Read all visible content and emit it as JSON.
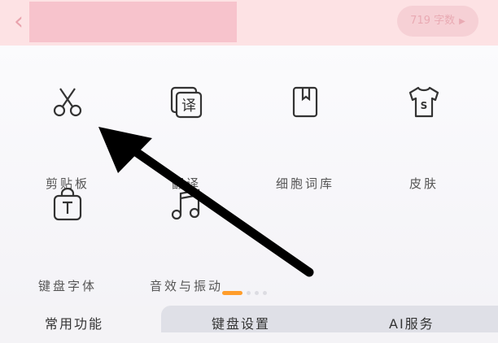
{
  "header": {
    "back_icon": "chevron-left-icon",
    "word_count": "719 字数",
    "word_count_icon": "triangle-right-icon"
  },
  "tools": [
    {
      "label": "剪贴板",
      "icon": "scissors-icon"
    },
    {
      "label": "翻译",
      "icon": "translate-icon"
    },
    {
      "label": "细胞词库",
      "icon": "bookmark-book-icon"
    },
    {
      "label": "皮肤",
      "icon": "tshirt-icon"
    },
    {
      "label": "键盘字体",
      "icon": "font-bag-icon"
    },
    {
      "label": "音效与振动",
      "icon": "music-note-icon"
    }
  ],
  "pager": {
    "active": 0,
    "count": 4
  },
  "tabs": [
    {
      "label": "常用功能"
    },
    {
      "label": "键盘设置"
    },
    {
      "label": "AI服务"
    }
  ],
  "colors": {
    "header_bg": "#fde2e4",
    "accent": "#ff9d2b",
    "tab_inactive_bg": "#dfe0e7"
  }
}
